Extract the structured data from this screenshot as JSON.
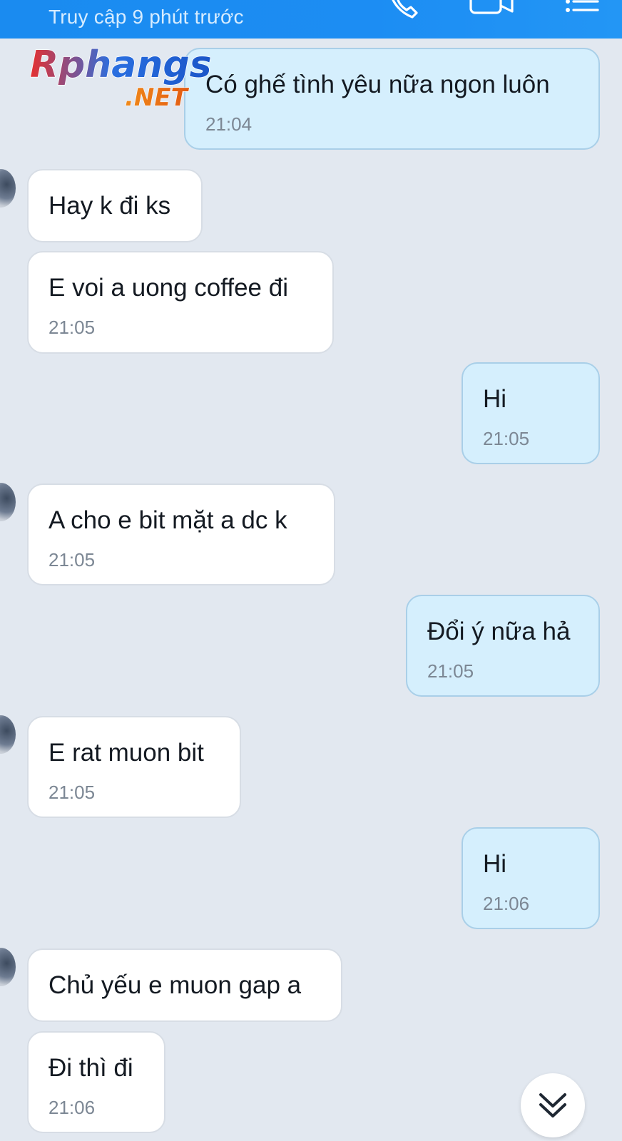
{
  "header": {
    "status": "Truy cập 9 phút trước"
  },
  "watermark": {
    "brand": "Rphangs",
    "brand_tld": ".NET"
  },
  "messages": [
    {
      "dir": "out",
      "text": "Có ghế tình yêu nữa ngon luôn",
      "time": "21:04"
    },
    {
      "dir": "in",
      "text": "Hay k đi ks",
      "time": ""
    },
    {
      "dir": "in",
      "text": "E voi a uong coffee đi",
      "time": "21:05"
    },
    {
      "dir": "out",
      "text": "Hi",
      "time": "21:05"
    },
    {
      "dir": "in",
      "text": "A cho e bit mặt a dc k",
      "time": "21:05"
    },
    {
      "dir": "out",
      "text": "Đổi ý nữa hả",
      "time": "21:05"
    },
    {
      "dir": "in",
      "text": "E rat muon bit",
      "time": "21:05"
    },
    {
      "dir": "out",
      "text": "Hi",
      "time": "21:06"
    },
    {
      "dir": "in",
      "text": "Chủ yếu e muon gap a",
      "time": ""
    },
    {
      "dir": "in",
      "text": "Đi thì đi",
      "time": "21:06"
    }
  ],
  "icons": {
    "call": "phone-icon",
    "video": "video-call-icon",
    "menu": "menu-icon",
    "scroll": "double-chevron-down-icon"
  },
  "colors": {
    "header": "#1c8df3",
    "outgoing_bubble": "#d5effd",
    "incoming_bubble": "#ffffff",
    "background": "#e2e8f0"
  }
}
